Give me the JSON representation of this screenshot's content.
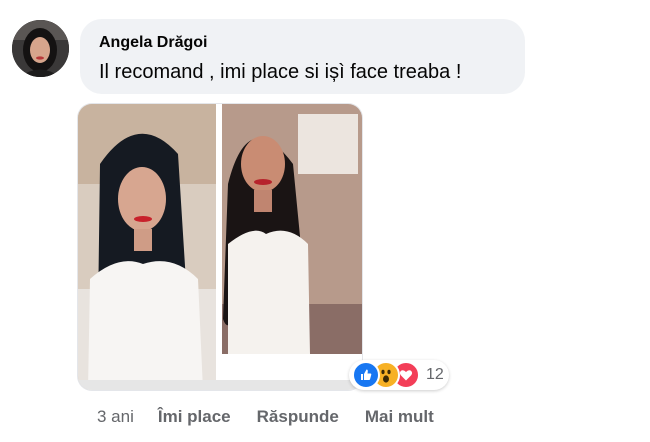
{
  "comment": {
    "author": "Angela Drăgoi",
    "text": "Il recomand , imi place si ișì face treaba !",
    "avatar_icon": "profile-photo"
  },
  "attachment": {
    "type": "photo",
    "panels": 2
  },
  "reactions": {
    "icons": [
      "like-icon",
      "wow-icon",
      "love-icon"
    ],
    "count": "12",
    "colors": {
      "like": "#1877f2",
      "wow": "#f7b125",
      "love": "#f33e58"
    }
  },
  "actions": {
    "time": "3 ani",
    "like_label": "Îmi place",
    "reply_label": "Răspunde",
    "more_label": "Mai mult"
  }
}
